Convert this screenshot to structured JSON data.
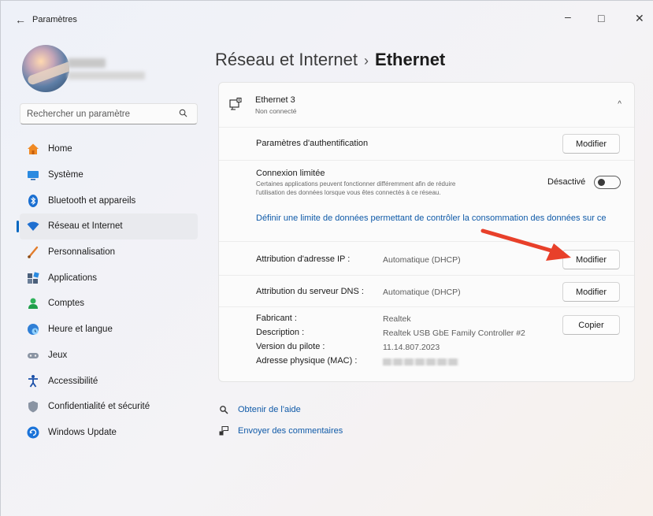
{
  "window": {
    "title": "Paramètres",
    "back_glyph": "←",
    "minimize_glyph": "–",
    "maximize_glyph": "□",
    "close_glyph": "✕"
  },
  "search": {
    "placeholder": "Rechercher un paramètre"
  },
  "sidebar": {
    "items": [
      {
        "label": "Home",
        "icon": "home-icon"
      },
      {
        "label": "Système",
        "icon": "system-icon"
      },
      {
        "label": "Bluetooth et appareils",
        "icon": "bluetooth-icon"
      },
      {
        "label": "Réseau et Internet",
        "icon": "wifi-icon",
        "active": true
      },
      {
        "label": "Personnalisation",
        "icon": "brush-icon"
      },
      {
        "label": "Applications",
        "icon": "apps-icon"
      },
      {
        "label": "Comptes",
        "icon": "account-icon"
      },
      {
        "label": "Heure et langue",
        "icon": "globe-clock-icon"
      },
      {
        "label": "Jeux",
        "icon": "gamepad-icon"
      },
      {
        "label": "Accessibilité",
        "icon": "accessibility-icon"
      },
      {
        "label": "Confidentialité et sécurité",
        "icon": "shield-icon"
      },
      {
        "label": "Windows Update",
        "icon": "update-icon"
      }
    ]
  },
  "breadcrumb": {
    "parent": "Réseau et Internet",
    "separator": "›",
    "current": "Ethernet"
  },
  "adapter": {
    "name": "Ethernet 3",
    "status": "Non connecté",
    "expanded_glyph": "^"
  },
  "auth": {
    "label": "Paramètres d'authentification",
    "button": "Modifier"
  },
  "metered": {
    "title": "Connexion limitée",
    "description_line1": "Certaines applications peuvent fonctionner différemment afin de réduire",
    "description_line2": "l'utilisation des données lorsque vous êtes connectés à ce réseau.",
    "state": "Désactivé",
    "link": "Définir une limite de données permettant de contrôler la consommation des données sur ce"
  },
  "ip": {
    "label": "Attribution d'adresse IP :",
    "value": "Automatique (DHCP)",
    "button": "Modifier"
  },
  "dns": {
    "label": "Attribution du serveur DNS :",
    "value": "Automatique (DHCP)",
    "button": "Modifier"
  },
  "details": {
    "manufacturer_label": "Fabricant :",
    "manufacturer": "Realtek",
    "description_label": "Description :",
    "description": "Realtek USB GbE Family Controller #2",
    "driver_label": "Version du pilote :",
    "driver": "11.14.807.2023",
    "mac_label": "Adresse physique (MAC) :",
    "copy_button": "Copier"
  },
  "footer": {
    "help": "Obtenir de l'aide",
    "feedback": "Envoyer des commentaires"
  },
  "colors": {
    "accent": "#0067c0",
    "link": "#0f5aa8",
    "arrow": "#e8402a"
  }
}
